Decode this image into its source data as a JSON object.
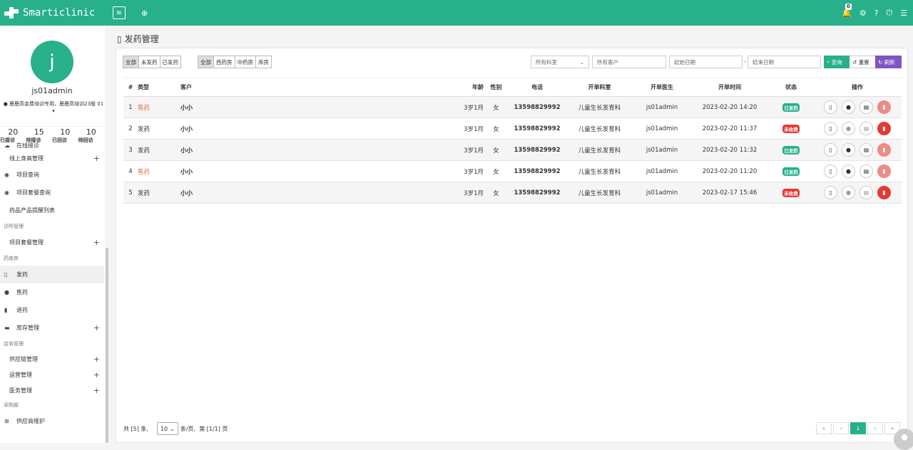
{
  "app": {
    "title": "Smarticlinic"
  },
  "topbar": {
    "menu_toggle": "≡",
    "nav_icon": "⊕",
    "notification_count": "0"
  },
  "user": {
    "avatar_letter": "j",
    "name": "js01admin",
    "clinic": "鹿鹿高金费培训专用，鹿鹿高培训23版 01"
  },
  "stats": [
    {
      "value": "20",
      "label": "已接诊"
    },
    {
      "value": "15",
      "label": "待接诊"
    },
    {
      "value": "10",
      "label": "已回访"
    },
    {
      "value": "10",
      "label": "待回访"
    }
  ],
  "menu": {
    "online": "在线接诊",
    "height": "线上身高管理",
    "project_query": "项目查询",
    "package_query": "项目套餐查询",
    "drug_reminder": "药品产品提醒列表",
    "sec_clinic": "诊所管理",
    "package_mgmt": "项目套餐管理",
    "sec_pharmacy": "药库房",
    "dispense": "发药",
    "sell": "售药",
    "return": "退药",
    "stock": "库存管理",
    "sec_store": "店务管理",
    "supply": "供应链管理",
    "ops": "运营管理",
    "medical": "医务管理",
    "sec_purchase": "采购部",
    "supplier": "供应商维护"
  },
  "page": {
    "title": "发药管理"
  },
  "filters": {
    "status": [
      "全部",
      "未发药",
      "已发药"
    ],
    "rooms": [
      "全部",
      "西药房",
      "中药房",
      "库房"
    ],
    "department": "所有科室",
    "customer_placeholder": "所有客户",
    "start_placeholder": "起始日期",
    "end_placeholder": "结束日期",
    "search_label": "查询",
    "reset_label": "重置",
    "refresh_label": "刷新"
  },
  "table": {
    "headers": [
      "#",
      "类型",
      "客户",
      "年龄",
      "性别",
      "电话",
      "开单科室",
      "开单医生",
      "开单时间",
      "状态",
      "操作"
    ],
    "rows": [
      {
        "no": "1",
        "type": "售药",
        "customer": "小小",
        "age": "3岁1月",
        "gender": "女",
        "phone": "13598829992",
        "dept": "儿童生长发育科",
        "doctor": "js01admin",
        "time": "2023-02-20 14:20",
        "status": "已发药"
      },
      {
        "no": "2",
        "type": "发药",
        "customer": "小小",
        "age": "3岁1月",
        "gender": "女",
        "phone": "13598829992",
        "dept": "儿童生长发育科",
        "doctor": "js01admin",
        "time": "2023-02-20 11:37",
        "status": "未收费"
      },
      {
        "no": "3",
        "type": "发药",
        "customer": "小小",
        "age": "3岁1月",
        "gender": "女",
        "phone": "13598829992",
        "dept": "儿童生长发育科",
        "doctor": "js01admin",
        "time": "2023-02-20 11:32",
        "status": "已发药"
      },
      {
        "no": "4",
        "type": "售药",
        "customer": "小小",
        "age": "3岁1月",
        "gender": "女",
        "phone": "13598829992",
        "dept": "儿童生长发育科",
        "doctor": "js01admin",
        "time": "2023-02-20 11:20",
        "status": "已发药"
      },
      {
        "no": "5",
        "type": "发药",
        "customer": "小小",
        "age": "3岁1月",
        "gender": "女",
        "phone": "13598829992",
        "dept": "儿童生长发育科",
        "doctor": "js01admin",
        "time": "2023-02-17 15:46",
        "status": "未收费"
      }
    ]
  },
  "footer": {
    "total": "共 [5] 条,",
    "page_size": "10",
    "per_page": "条/页,",
    "page_info": "第 [1/1] 页"
  },
  "pager": {
    "first": "«",
    "prev": "‹",
    "current": "1",
    "next": "›",
    "last": "»"
  },
  "colors": {
    "brand": "#27b08a",
    "paid": "#27b08a",
    "unpaid": "#e53935",
    "orange": "#e8702a",
    "refresh": "#7e57c2"
  }
}
